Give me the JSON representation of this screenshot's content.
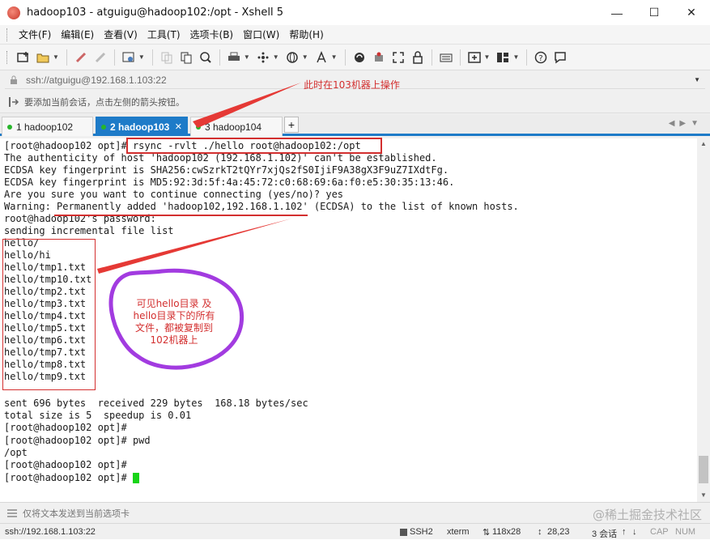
{
  "window": {
    "title": "hadoop103 - atguigu@hadoop102:/opt - Xshell 5"
  },
  "menu": {
    "items": [
      "文件(F)",
      "编辑(E)",
      "查看(V)",
      "工具(T)",
      "选项卡(B)",
      "窗口(W)",
      "帮助(H)"
    ]
  },
  "address": {
    "text": "ssh://atguigu@192.168.1.103:22"
  },
  "hint": {
    "text": "要添加当前会话，点击左侧的箭头按钮。"
  },
  "tabs": [
    {
      "label": "1 hadoop102",
      "active": false
    },
    {
      "label": "2 hadoop103",
      "active": true
    },
    {
      "label": "3 hadoop104",
      "active": false
    }
  ],
  "terminal": {
    "lines": [
      "[root@hadoop102 opt]# rsync -rvlt ./hello root@hadoop102:/opt",
      "The authenticity of host 'hadoop102 (192.168.1.102)' can't be established.",
      "ECDSA key fingerprint is SHA256:cwSzrkT2tQYr7xjQs2fS0IjiF9A38gX3F9uZ7IXdtFg.",
      "ECDSA key fingerprint is MD5:92:3d:5f:4a:45:72:c0:68:69:6a:f0:e5:30:35:13:46.",
      "Are you sure you want to continue connecting (yes/no)? yes",
      "Warning: Permanently added 'hadoop102,192.168.1.102' (ECDSA) to the list of known hosts.",
      "root@hadoop102's password:",
      "sending incremental file list",
      "hello/",
      "hello/hi",
      "hello/tmp1.txt",
      "hello/tmp10.txt",
      "hello/tmp2.txt",
      "hello/tmp3.txt",
      "hello/tmp4.txt",
      "hello/tmp5.txt",
      "hello/tmp6.txt",
      "hello/tmp7.txt",
      "hello/tmp8.txt",
      "hello/tmp9.txt",
      "",
      "sent 696 bytes  received 229 bytes  168.18 bytes/sec",
      "total size is 5  speedup is 0.01",
      "[root@hadoop102 opt]#",
      "[root@hadoop102 opt]# pwd",
      "/opt",
      "[root@hadoop102 opt]#",
      "[root@hadoop102 opt]# "
    ]
  },
  "annotations": {
    "note_103": "此时在103机器上操作",
    "bubble_lines": [
      "可见hello目录 及",
      "hello目录下的所有",
      "文件，都被复制到",
      "102机器上"
    ]
  },
  "send": {
    "text": "仅将文本发送到当前选项卡"
  },
  "watermark": "@稀土掘金技术社区",
  "status": {
    "address": "ssh://192.168.1.103:22",
    "protocol": "SSH2",
    "terminal": "xterm",
    "size": "118x28",
    "cursor": "28,23",
    "sessions": "3 会话",
    "cap": "CAP",
    "num": "NUM"
  },
  "colors": {
    "accent": "#1e7bc8",
    "annotation": "#d32f2f",
    "bubble": "#a23be0",
    "cursor": "#18d418"
  }
}
